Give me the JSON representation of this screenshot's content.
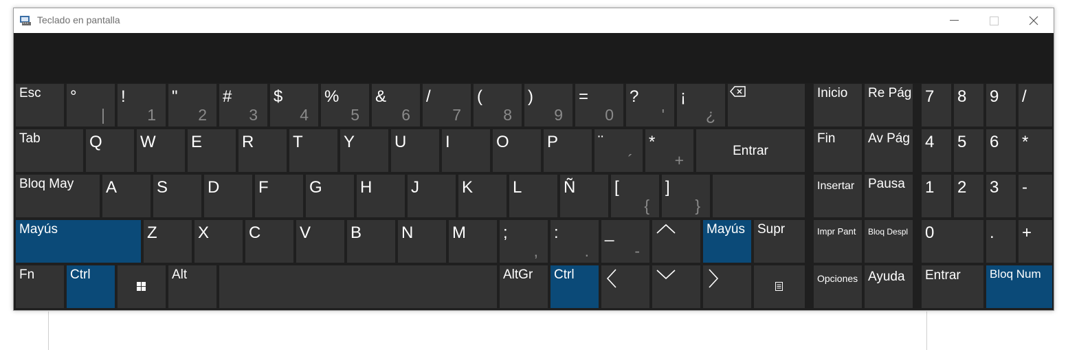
{
  "window": {
    "title": "Teclado en pantalla"
  },
  "colors": {
    "key": "#333333",
    "active_key": "#0b4a78",
    "background": "#1f1f1f"
  },
  "keys": {
    "esc": "Esc",
    "k1_top": "°",
    "k1_sub": "|",
    "k2_top": "!",
    "k2_sub": "1",
    "k3_top": "\"",
    "k3_sub": "2",
    "k4_top": "#",
    "k4_sub": "3",
    "k5_top": "$",
    "k5_sub": "4",
    "k6_top": "%",
    "k6_sub": "5",
    "k7_top": "&",
    "k7_sub": "6",
    "k8_top": "/",
    "k8_sub": "7",
    "k9_top": "(",
    "k9_sub": "8",
    "k10_top": ")",
    "k10_sub": "9",
    "k11_top": "=",
    "k11_sub": "0",
    "k12_top": "?",
    "k12_sub": "'",
    "k13_top": "¡",
    "k13_sub": "¿",
    "tab": "Tab",
    "q": "Q",
    "w": "W",
    "e": "E",
    "r": "R",
    "t": "T",
    "y": "Y",
    "u": "U",
    "i": "I",
    "o": "O",
    "p": "P",
    "diaeresis_top": "¨",
    "diaeresis_sub": "´",
    "star_top": "*",
    "star_sub": "+",
    "enter": "Entrar",
    "caps": "Bloq May",
    "a": "A",
    "s": "S",
    "d": "D",
    "f": "F",
    "g": "G",
    "h": "H",
    "j": "J",
    "k": "K",
    "l": "L",
    "enye": "Ñ",
    "bracket_open_top": "[",
    "bracket_open_sub": "{",
    "bracket_close_top": "]",
    "bracket_close_sub": "}",
    "shift": "Mayús",
    "z": "Z",
    "x": "X",
    "c": "C",
    "v": "V",
    "b": "B",
    "n": "N",
    "m": "M",
    "semicolon_top": ";",
    "semicolon_sub": ",",
    "colon_top": ":",
    "colon_sub": ".",
    "underscore_top": "_",
    "underscore_sub": "-",
    "shift_right": "Mayús",
    "del": "Supr",
    "fn": "Fn",
    "ctrl": "Ctrl",
    "alt": "Alt",
    "altgr": "AltGr",
    "ctrl_right": "Ctrl",
    "home": "Inicio",
    "pgup": "Re Pág",
    "end": "Fin",
    "pgdn": "Av Pág",
    "insert": "Insertar",
    "pause": "Pausa",
    "prtscn": "Impr Pant",
    "scrlk": "Bloq Despl",
    "options": "Opciones",
    "help": "Ayuda",
    "n7": "7",
    "n8": "8",
    "n9": "9",
    "ndiv": "/",
    "n4": "4",
    "n5": "5",
    "n6": "6",
    "nmul": "*",
    "n1": "1",
    "n2": "2",
    "n3": "3",
    "nminus": "-",
    "n0": "0",
    "ndot": ".",
    "nplus": "+",
    "nenter": "Entrar",
    "numlock": "Bloq Num"
  },
  "icons": {
    "backspace": "backspace-icon",
    "up": "arrow-up-icon",
    "down": "arrow-down-icon",
    "left": "arrow-left-icon",
    "right": "arrow-right-icon",
    "windows": "windows-logo-icon",
    "menu": "context-menu-icon",
    "app": "keyboard-app-icon"
  }
}
